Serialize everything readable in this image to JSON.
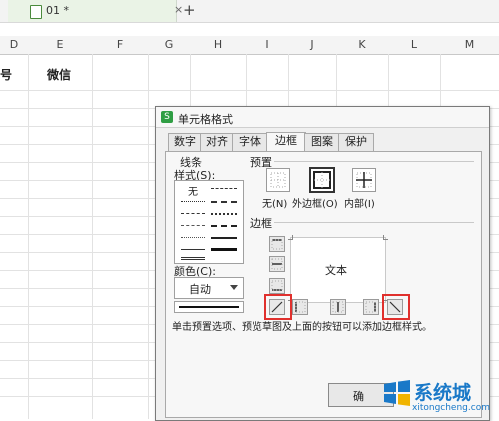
{
  "tab_bar": {
    "document_title": "01 *",
    "close_symbol": "×",
    "new_tab_symbol": "+"
  },
  "sheet": {
    "columns": [
      "D",
      "E",
      "F",
      "G",
      "H",
      "I",
      "J",
      "K",
      "L",
      "M"
    ],
    "header_cells": [
      "号",
      "微信"
    ]
  },
  "dialog": {
    "logo": "S",
    "title": "单元格格式",
    "tabs": [
      {
        "label": "数字"
      },
      {
        "label": "对齐"
      },
      {
        "label": "字体"
      },
      {
        "label": "边框",
        "active": true
      },
      {
        "label": "图案"
      },
      {
        "label": "保护"
      }
    ],
    "line_group_label": "线条",
    "style_label": "样式(S):",
    "style_none": "无",
    "color_label": "颜色(C):",
    "color_value": "自动",
    "preset_group_label": "预置",
    "presets": [
      {
        "label": "无(N)"
      },
      {
        "label": "外边框(O)"
      },
      {
        "label": "内部(I)"
      }
    ],
    "border_group_label": "边框",
    "preview_text": "文本",
    "hint_text": "单击预置选项、预览草图及上面的按钮可以添加边框样式。",
    "ok_label": "确"
  },
  "watermark": {
    "name": "系统城",
    "domain": "xitongcheng.com",
    "colors": {
      "brand": "#1a79c8",
      "highlight": "#e0302d"
    }
  }
}
